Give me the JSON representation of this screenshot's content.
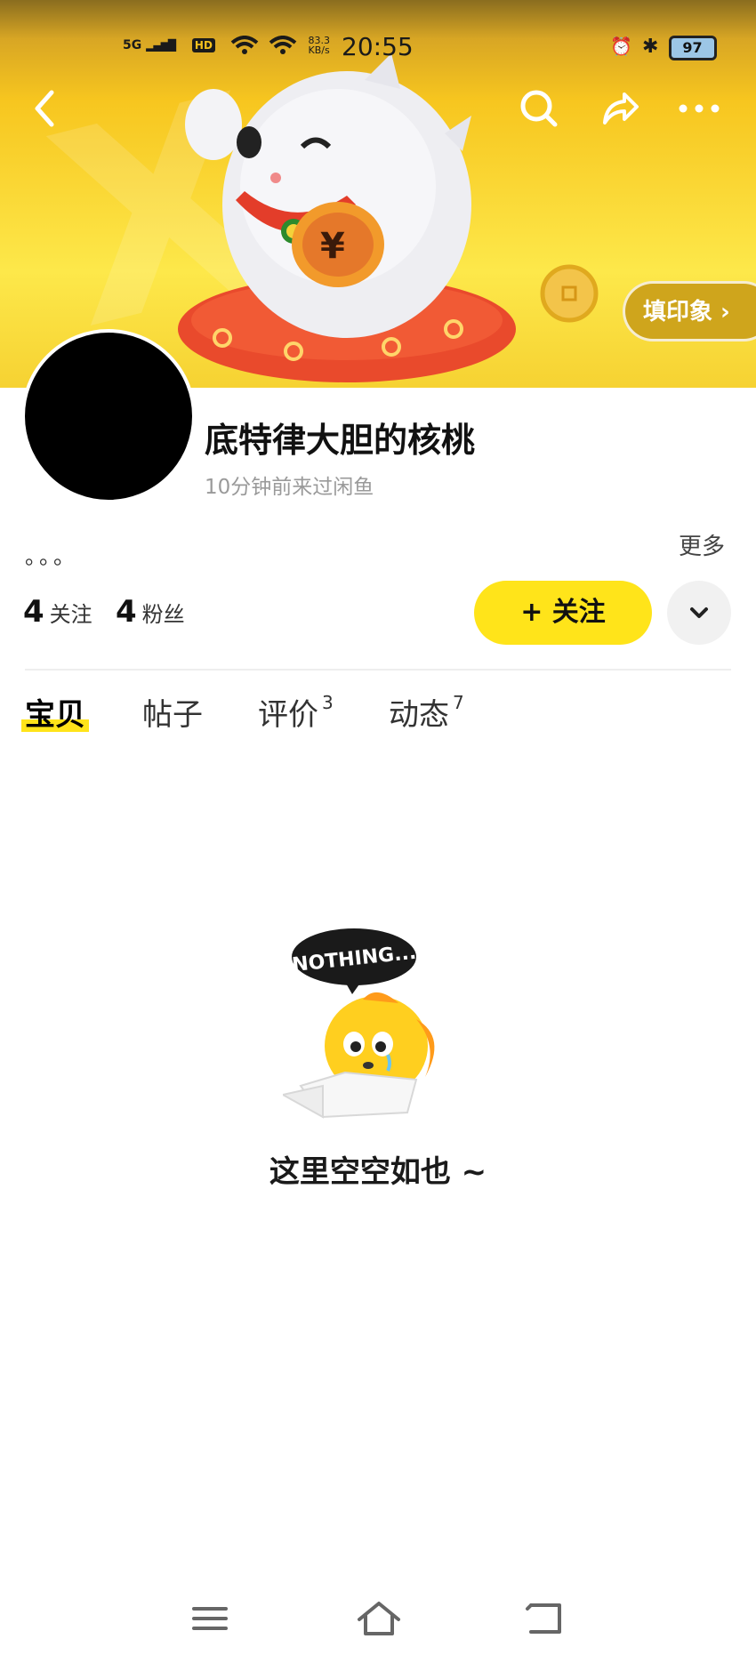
{
  "status_bar": {
    "network": "5G",
    "hd": "HD",
    "speed": "83.3\nKB/s",
    "time": "20:55",
    "battery": "97"
  },
  "banner": {
    "fill_impression_label": "填印象 ›"
  },
  "profile": {
    "username": "底特律大胆的核桃",
    "last_seen": "10分钟前来过闲鱼",
    "bio": "。。。",
    "more_label": "更多",
    "following_count": "4",
    "following_label": "关注",
    "followers_count": "4",
    "followers_label": "粉丝",
    "follow_button": "+ 关注"
  },
  "tabs": [
    {
      "label": "宝贝",
      "badge": ""
    },
    {
      "label": "帖子",
      "badge": ""
    },
    {
      "label": "评价",
      "badge": "3"
    },
    {
      "label": "动态",
      "badge": "7"
    }
  ],
  "empty_state": {
    "badge_text": "NOTHING...",
    "message": "这里空空如也 ~"
  },
  "colors": {
    "accent": "#ffe41a",
    "banner_top": "#8a6d1f",
    "banner_main": "#fde84a"
  },
  "icons": {
    "back": "chevron-left-icon",
    "search": "search-icon",
    "share": "share-icon",
    "more": "more-dots-icon",
    "dropdown": "chevron-down-icon",
    "nav_menu": "menu-icon",
    "nav_home": "home-icon",
    "nav_back": "back-icon"
  }
}
